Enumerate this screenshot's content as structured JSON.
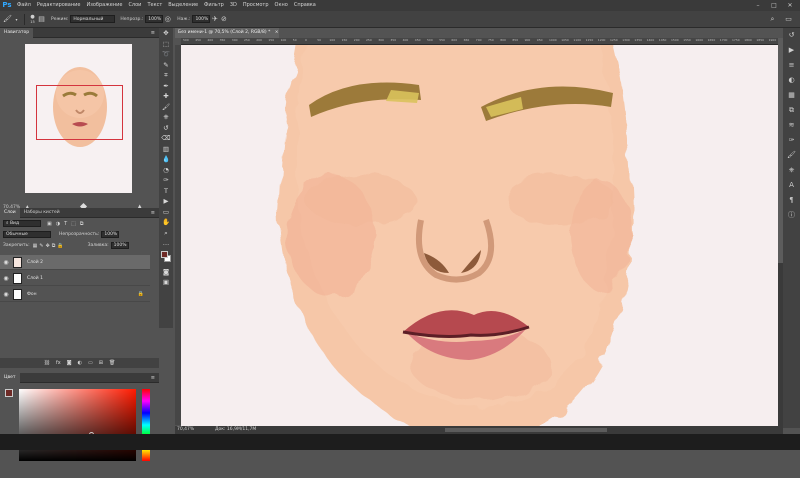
{
  "app": {
    "logo": "Ps"
  },
  "menu": [
    "Файл",
    "Редактирование",
    "Изображение",
    "Слои",
    "Текст",
    "Выделение",
    "Фильтр",
    "3D",
    "Просмотр",
    "Окно",
    "Справка"
  ],
  "window_controls": {
    "minimize": "–",
    "maximize": "□",
    "close": "✕"
  },
  "options_bar": {
    "brush_size": "15",
    "mode_label": "Режим:",
    "mode_value": "Нормальный",
    "opacity_label": "Непрозр.:",
    "opacity_value": "100%",
    "flow_label": "Наж.:",
    "flow_value": "100%"
  },
  "navigator": {
    "tab": "Навигатор",
    "zoom": "70,47%"
  },
  "layers": {
    "tabs": [
      "Слои",
      "Наборы кистей"
    ],
    "search_placeholder": "Вид",
    "blend_mode": "Обычные",
    "opacity_label": "Непрозрачность:",
    "opacity_value": "100%",
    "lock_label": "Закрепить:",
    "fill_label": "Заливка:",
    "fill_value": "100%",
    "items": [
      {
        "name": "Слой 2",
        "selected": true
      },
      {
        "name": "Слой 1",
        "selected": false
      },
      {
        "name": "Фон",
        "selected": false
      }
    ]
  },
  "color_panel": {
    "tab": "Цвет",
    "foreground": "#6e2a26",
    "background": "#ffffff"
  },
  "document": {
    "tab_label": "Без имени-1 @ 70,5% (Слой 2, RGB/8) *",
    "close": "×"
  },
  "ruler_ticks": [
    "500",
    "450",
    "400",
    "350",
    "300",
    "250",
    "200",
    "150",
    "100",
    "50",
    "0",
    "50",
    "100",
    "150",
    "200",
    "250",
    "300",
    "350",
    "400",
    "450",
    "500",
    "550",
    "600",
    "650",
    "700",
    "750",
    "800",
    "850",
    "900",
    "950",
    "1000",
    "1050",
    "1100",
    "1150",
    "1200",
    "1250",
    "1300",
    "1350",
    "1400",
    "1450",
    "1500",
    "1550",
    "1600",
    "1650",
    "1700",
    "1750",
    "1800",
    "1850",
    "1900"
  ],
  "status": {
    "zoom": "70,47%",
    "doc": "Док: 16,9M/11,7M"
  },
  "colors": {
    "menubar": "#3a3a3a",
    "panel": "#535353",
    "canvas": "#f6eeef",
    "accent": "#31a8ff",
    "nav_box": "#d4343e"
  }
}
